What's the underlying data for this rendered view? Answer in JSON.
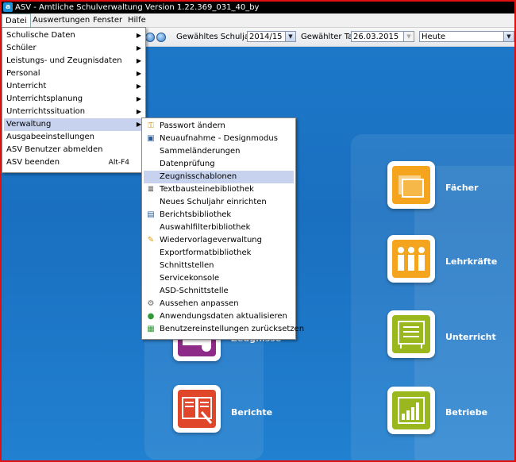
{
  "window": {
    "title": "ASV - Amtliche Schulverwaltung Version 1.22.369_031_40_by",
    "app_icon": "a"
  },
  "menubar": {
    "items": [
      {
        "label": "Datei"
      },
      {
        "label": "Auswertungen"
      },
      {
        "label": "Fenster"
      },
      {
        "label": "Hilfe"
      }
    ]
  },
  "toolbar": {
    "schuljahr_label": "Gewähltes Schuljahr",
    "schuljahr_value": "2014/15",
    "tag_label": "Gewählter Tag",
    "tag_value": "26.03.2015",
    "tag_mode_value": "Heute"
  },
  "datei_menu": {
    "items": [
      {
        "label": "Schulische Daten",
        "submenu": true
      },
      {
        "label": "Schüler",
        "submenu": true
      },
      {
        "label": "Leistungs- und Zeugnisdaten",
        "submenu": true
      },
      {
        "label": "Personal",
        "submenu": true
      },
      {
        "label": "Unterricht",
        "submenu": true
      },
      {
        "label": "Unterrichtsplanung",
        "submenu": true
      },
      {
        "label": "Unterrichtssituation",
        "submenu": true
      },
      {
        "label": "Verwaltung",
        "submenu": true,
        "highlighted": true
      },
      {
        "label": "Ausgabeeinstellungen",
        "submenu": false
      },
      {
        "label": "ASV Benutzer abmelden",
        "submenu": false
      },
      {
        "label": "ASV beenden",
        "submenu": false,
        "shortcut": "Alt-F4"
      }
    ]
  },
  "verwaltung_menu": {
    "items": [
      {
        "label": "Passwort ändern",
        "icon": "key-icon"
      },
      {
        "label": "Neuaufnahme - Designmodus",
        "icon": "window-icon"
      },
      {
        "label": "Sammeländerungen",
        "icon": ""
      },
      {
        "label": "Datenprüfung",
        "icon": ""
      },
      {
        "label": "Zeugnisschablonen",
        "icon": "",
        "highlighted": true
      },
      {
        "label": "Textbausteinebibliothek",
        "icon": "text-icon"
      },
      {
        "label": "Neues Schuljahr einrichten",
        "icon": ""
      },
      {
        "label": "Berichtsbibliothek",
        "icon": "report-icon"
      },
      {
        "label": "Auswahlfilterbibliothek",
        "icon": ""
      },
      {
        "label": "Wiedervorlageverwaltung",
        "icon": "broom-icon"
      },
      {
        "label": "Exportformatbibliothek",
        "icon": ""
      },
      {
        "label": "Schnittstellen",
        "icon": ""
      },
      {
        "label": "Servicekonsole",
        "icon": ""
      },
      {
        "label": "ASD-Schnittstelle",
        "icon": ""
      },
      {
        "label": "Aussehen anpassen",
        "icon": "gear-icon"
      },
      {
        "label": "Anwendungsdaten aktualisieren",
        "icon": "globe-icon"
      },
      {
        "label": "Benutzereinstellungen zurücksetzen",
        "icon": "reset-icon"
      }
    ]
  },
  "tiles": {
    "faecher": "Fächer",
    "lehrkraefte": "Lehrkräfte",
    "unterricht": "Unterricht",
    "zeugnisse": "Zeugnisse",
    "berichte": "Berichte",
    "betriebe": "Betriebe"
  },
  "colors": {
    "accent_blue": "#1d78c9",
    "tile_orange": "#f5a51d",
    "tile_green": "#9ab81e",
    "tile_red": "#e0462a",
    "tile_purple": "#8e2a87",
    "menu_highlight": "#c7d3ee"
  }
}
